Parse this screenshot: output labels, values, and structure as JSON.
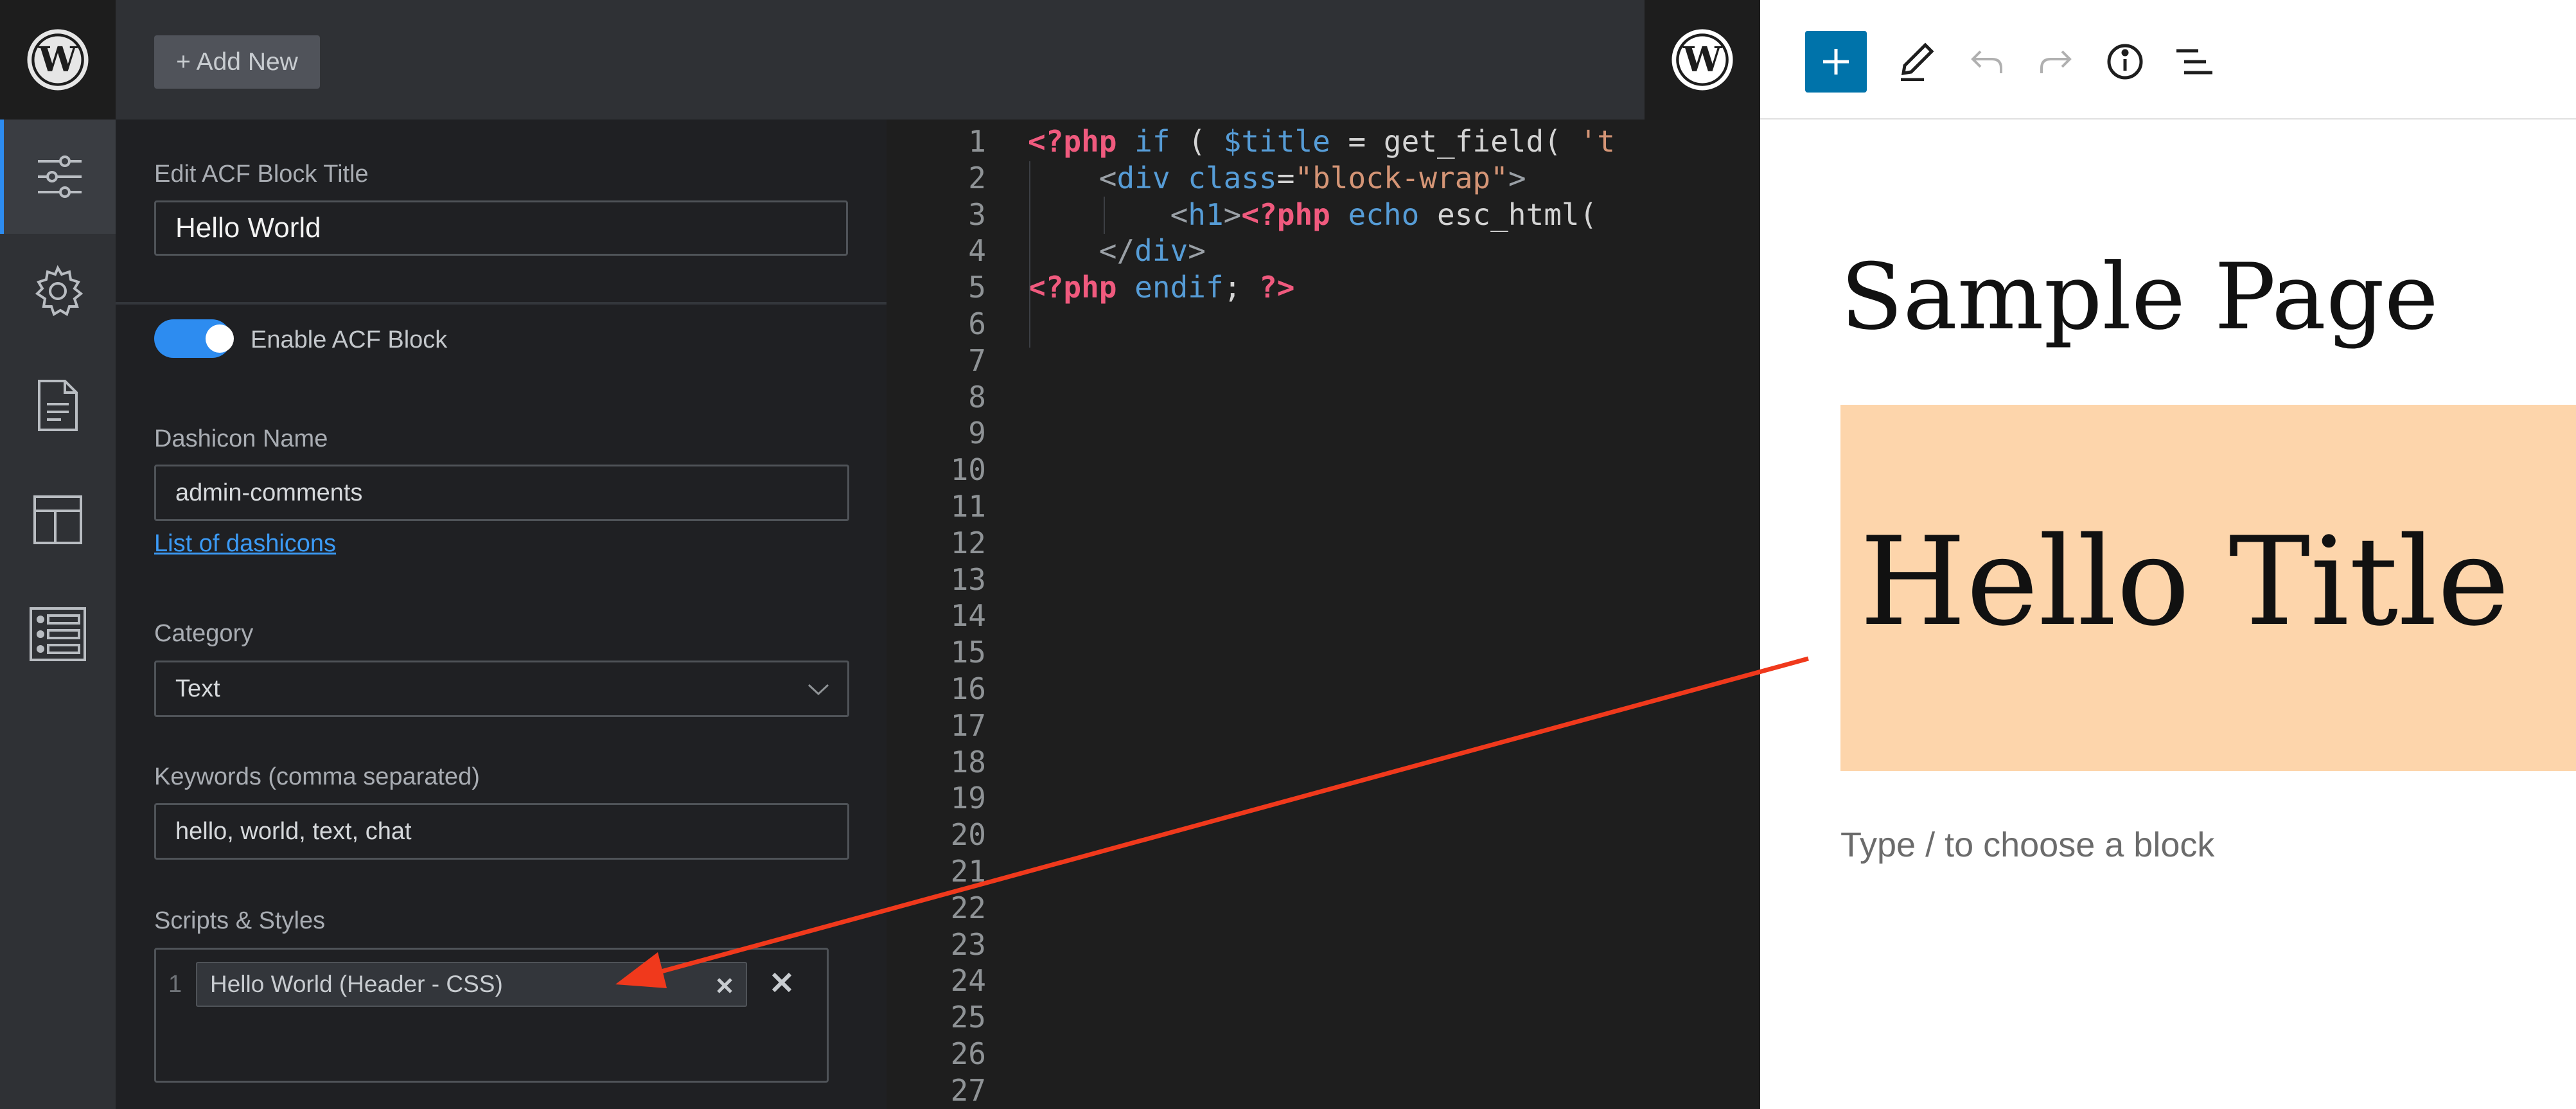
{
  "toolbar": {
    "add_new": "+ Add New"
  },
  "settings": {
    "block_title_label": "Edit ACF Block Title",
    "block_title_value": "Hello World",
    "enable_label": "Enable ACF Block",
    "enable_on": true,
    "dashicon_label": "Dashicon Name",
    "dashicon_value": "admin-comments",
    "dashicon_link": "List of dashicons",
    "category_label": "Category",
    "category_value": "Text",
    "keywords_label": "Keywords (comma separated)",
    "keywords_value": "hello, world, text, chat",
    "scripts_label": "Scripts & Styles",
    "script_index": "1",
    "script_tag": "Hello World (Header - CSS)"
  },
  "sidebar_icons": [
    "sliders-icon",
    "gear-icon",
    "document-icon",
    "layout-icon",
    "list-icon"
  ],
  "code": {
    "line_numbers": [
      "1",
      "2",
      "3",
      "4",
      "5",
      "6",
      "7",
      "8",
      "9",
      "10",
      "11",
      "12",
      "13",
      "14",
      "15",
      "16",
      "17",
      "18",
      "19",
      "20",
      "21",
      "22",
      "23",
      "24",
      "25",
      "26",
      "27"
    ],
    "lines": [
      [
        {
          "c": "k",
          "t": "<?php"
        },
        {
          "c": "b",
          "t": " if"
        },
        {
          "c": "p",
          "t": " ( "
        },
        {
          "c": "b",
          "t": "$title"
        },
        {
          "c": "p",
          "t": " = get_field( "
        },
        {
          "c": "s",
          "t": "'t"
        }
      ],
      [
        {
          "c": "p",
          "t": "    "
        },
        {
          "c": "t",
          "t": "<"
        },
        {
          "c": "b",
          "t": "div"
        },
        {
          "c": "p",
          "t": " "
        },
        {
          "c": "b",
          "t": "class"
        },
        {
          "c": "p",
          "t": "="
        },
        {
          "c": "s",
          "t": "\"block-wrap\""
        },
        {
          "c": "t",
          "t": ">"
        }
      ],
      [
        {
          "c": "p",
          "t": "        "
        },
        {
          "c": "t",
          "t": "<"
        },
        {
          "c": "b",
          "t": "h1"
        },
        {
          "c": "t",
          "t": ">"
        },
        {
          "c": "k",
          "t": "<?php"
        },
        {
          "c": "b",
          "t": " echo"
        },
        {
          "c": "p",
          "t": " esc_html("
        }
      ],
      [
        {
          "c": "p",
          "t": "    "
        },
        {
          "c": "t",
          "t": "</"
        },
        {
          "c": "b",
          "t": "div"
        },
        {
          "c": "t",
          "t": ">"
        }
      ],
      [
        {
          "c": "k",
          "t": "<?php"
        },
        {
          "c": "b",
          "t": " endif"
        },
        {
          "c": "p",
          "t": "; "
        },
        {
          "c": "k",
          "t": "?>"
        }
      ]
    ]
  },
  "preview": {
    "page_title": "Sample Page",
    "hero_title": "Hello Title",
    "type_hint": "Type / to choose a block"
  },
  "colors": {
    "accent": "#2d8cf0",
    "hero_bg": "#fdd5ab",
    "arrow": "#f0391c",
    "wp_blue": "#0073aa"
  }
}
